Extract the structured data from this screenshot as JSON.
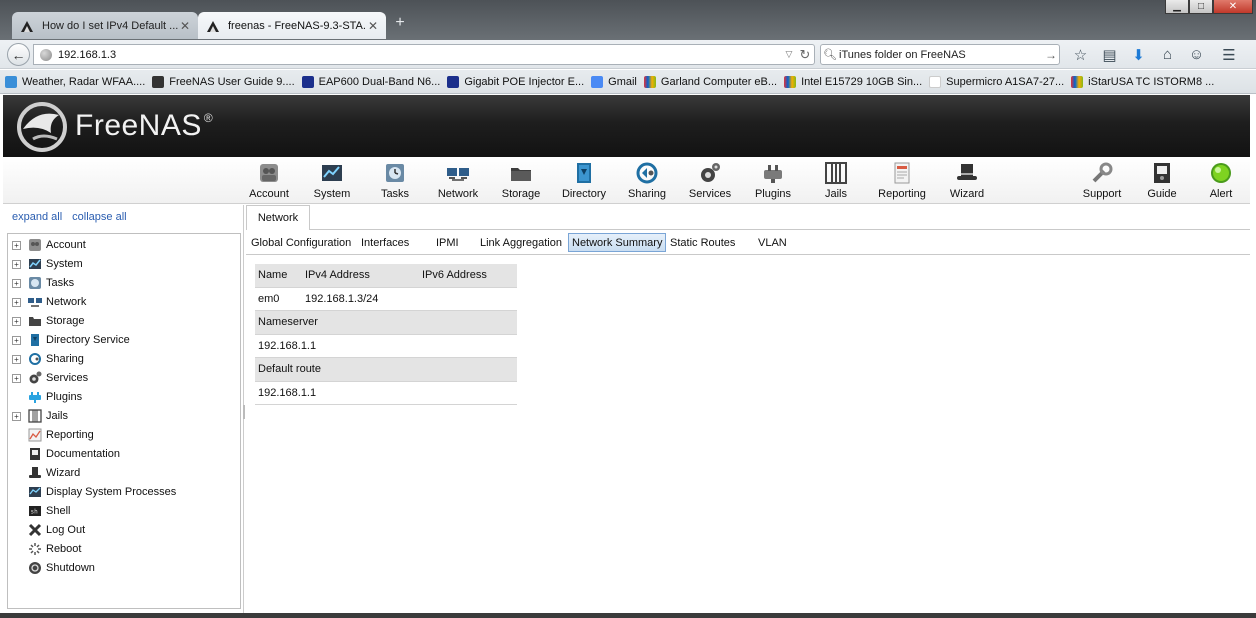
{
  "browser": {
    "tabs": [
      {
        "title": "How do I set IPv4 Default ...",
        "active": false
      },
      {
        "title": "freenas - FreeNAS-9.3-STA...",
        "active": true
      }
    ],
    "new_tab": "+",
    "url": "192.168.1.3",
    "search_text": "iTunes folder on FreeNAS",
    "bookmarks": [
      {
        "label": "Weather, Radar WFAA....",
        "icon": "weather-icon"
      },
      {
        "label": "FreeNAS User Guide 9....",
        "icon": "freenas-icon"
      },
      {
        "label": "EAP600 Dual-Band N6...",
        "icon": "engenius-icon"
      },
      {
        "label": "Gigabit POE Injector E...",
        "icon": "engenius-icon"
      },
      {
        "label": "Gmail",
        "icon": "google-icon"
      },
      {
        "label": "Garland Computer eB...",
        "icon": "ebay-icon"
      },
      {
        "label": "Intel E15729 10GB Sin...",
        "icon": "ebay-icon"
      },
      {
        "label": "Supermicro A1SA7-27...",
        "icon": "amazon-icon"
      },
      {
        "label": "iStarUSA TC ISTORM8 ...",
        "icon": "ebay-icon"
      }
    ]
  },
  "app": {
    "brand": "FreeNAS",
    "brand_mark": "®"
  },
  "toolbar": [
    {
      "label": "Account",
      "icon": "account-icon"
    },
    {
      "label": "System",
      "icon": "system-icon"
    },
    {
      "label": "Tasks",
      "icon": "tasks-icon"
    },
    {
      "label": "Network",
      "icon": "network-icon"
    },
    {
      "label": "Storage",
      "icon": "storage-icon"
    },
    {
      "label": "Directory",
      "icon": "directory-icon"
    },
    {
      "label": "Sharing",
      "icon": "sharing-icon"
    },
    {
      "label": "Services",
      "icon": "services-icon"
    },
    {
      "label": "Plugins",
      "icon": "plugins-icon"
    },
    {
      "label": "Jails",
      "icon": "jails-icon"
    },
    {
      "label": "Reporting",
      "icon": "reporting-icon"
    },
    {
      "label": "Wizard",
      "icon": "wizard-icon"
    },
    {
      "label": "Support",
      "icon": "support-icon"
    },
    {
      "label": "Guide",
      "icon": "guide-icon"
    },
    {
      "label": "Alert",
      "icon": "alert-icon"
    }
  ],
  "sidebar": {
    "expand_all": "expand all",
    "collapse_all": "collapse all",
    "items": [
      {
        "label": "Account",
        "expandable": true
      },
      {
        "label": "System",
        "expandable": true
      },
      {
        "label": "Tasks",
        "expandable": true
      },
      {
        "label": "Network",
        "expandable": true
      },
      {
        "label": "Storage",
        "expandable": true
      },
      {
        "label": "Directory Service",
        "expandable": true
      },
      {
        "label": "Sharing",
        "expandable": true
      },
      {
        "label": "Services",
        "expandable": true
      },
      {
        "label": "Plugins",
        "expandable": false
      },
      {
        "label": "Jails",
        "expandable": true
      },
      {
        "label": "Reporting",
        "expandable": false
      },
      {
        "label": "Documentation",
        "expandable": false
      },
      {
        "label": "Wizard",
        "expandable": false
      },
      {
        "label": "Display System Processes",
        "expandable": false
      },
      {
        "label": "Shell",
        "expandable": false
      },
      {
        "label": "Log Out",
        "expandable": false
      },
      {
        "label": "Reboot",
        "expandable": false
      },
      {
        "label": "Shutdown",
        "expandable": false
      }
    ]
  },
  "main": {
    "tab": "Network",
    "subtabs": [
      {
        "label": "Global Configuration",
        "active": false
      },
      {
        "label": "Interfaces",
        "active": false
      },
      {
        "label": "IPMI",
        "active": false
      },
      {
        "label": "Link Aggregation",
        "active": false
      },
      {
        "label": "Network Summary",
        "active": true
      },
      {
        "label": "Static Routes",
        "active": false
      },
      {
        "label": "VLAN",
        "active": false
      }
    ],
    "summary": {
      "headers": {
        "name": "Name",
        "ipv4": "IPv4 Address",
        "ipv6": "IPv6 Address"
      },
      "interfaces": [
        {
          "name": "em0",
          "ipv4": "192.168.1.3/24",
          "ipv6": ""
        }
      ],
      "nameserver_header": "Nameserver",
      "nameserver": "192.168.1.1",
      "default_route_header": "Default route",
      "default_route": "192.168.1.1"
    }
  },
  "colors": {
    "header_bg": "#1e1e1e",
    "active_subtab": "#c9ddf1",
    "link": "#2a5db0",
    "alert_green": "#6fcf2f"
  }
}
